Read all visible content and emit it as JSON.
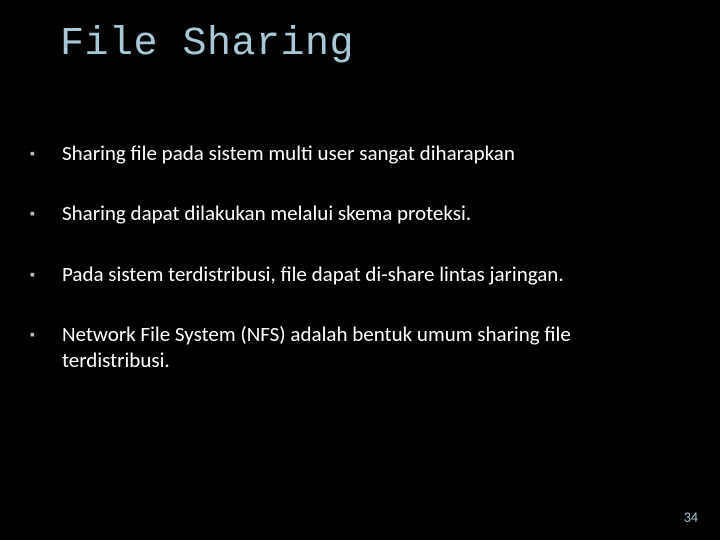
{
  "title": "File Sharing",
  "bullets": [
    "Sharing file pada sistem multi user sangat diharapkan",
    "Sharing dapat dilakukan melalui skema proteksi.",
    "Pada sistem terdistribusi, file dapat di-share lintas jaringan.",
    "Network File System (NFS) adalah bentuk umum sharing file terdistribusi."
  ],
  "page_number": "34",
  "bullet_marker": "▪"
}
